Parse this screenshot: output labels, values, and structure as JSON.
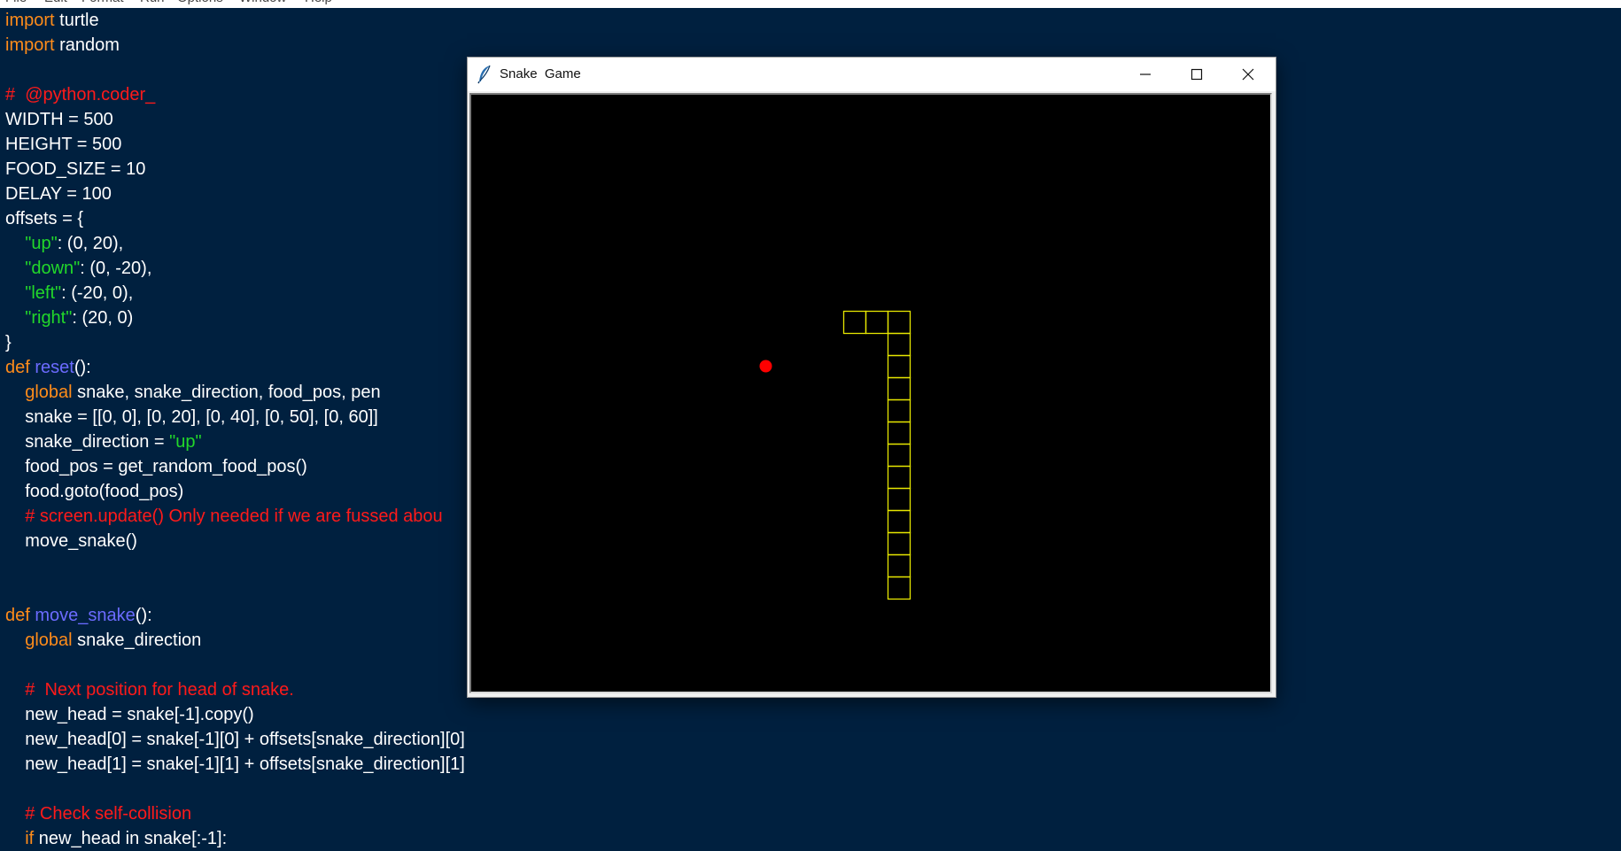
{
  "menubar": {
    "items": [
      "File",
      "Edit",
      "Format",
      "Run",
      "Options",
      "Window",
      "Help"
    ]
  },
  "editor": {
    "lines": [
      [
        {
          "t": "import",
          "c": "kw"
        },
        {
          "t": " turtle",
          "c": "n"
        }
      ],
      [
        {
          "t": "import",
          "c": "kw"
        },
        {
          "t": " random",
          "c": "n"
        }
      ],
      [],
      [
        {
          "t": "#  @python.coder_",
          "c": "cm"
        }
      ],
      [
        {
          "t": "WIDTH = 500",
          "c": "n"
        }
      ],
      [
        {
          "t": "HEIGHT = 500",
          "c": "n"
        }
      ],
      [
        {
          "t": "FOOD_SIZE = 10",
          "c": "n"
        }
      ],
      [
        {
          "t": "DELAY = 100",
          "c": "n"
        }
      ],
      [
        {
          "t": "offsets = {",
          "c": "n"
        }
      ],
      [
        {
          "t": "    ",
          "c": "n"
        },
        {
          "t": "\"up\"",
          "c": "str"
        },
        {
          "t": ": (0, 20),",
          "c": "n"
        }
      ],
      [
        {
          "t": "    ",
          "c": "n"
        },
        {
          "t": "\"down\"",
          "c": "str"
        },
        {
          "t": ": (0, -20),",
          "c": "n"
        }
      ],
      [
        {
          "t": "    ",
          "c": "n"
        },
        {
          "t": "\"left\"",
          "c": "str"
        },
        {
          "t": ": (-20, 0),",
          "c": "n"
        }
      ],
      [
        {
          "t": "    ",
          "c": "n"
        },
        {
          "t": "\"right\"",
          "c": "str"
        },
        {
          "t": ": (20, 0)",
          "c": "n"
        }
      ],
      [
        {
          "t": "}",
          "c": "n"
        }
      ],
      [
        {
          "t": "def",
          "c": "kw"
        },
        {
          "t": " ",
          "c": "n"
        },
        {
          "t": "reset",
          "c": "fn"
        },
        {
          "t": "():",
          "c": "n"
        }
      ],
      [
        {
          "t": "    ",
          "c": "n"
        },
        {
          "t": "global",
          "c": "kw"
        },
        {
          "t": " snake, snake_direction, food_pos, pen",
          "c": "n"
        }
      ],
      [
        {
          "t": "    snake = [[0, 0], [0, 20], [0, 40], [0, 50], [0, 60]]",
          "c": "n"
        }
      ],
      [
        {
          "t": "    snake_direction = ",
          "c": "n"
        },
        {
          "t": "\"up\"",
          "c": "str"
        }
      ],
      [
        {
          "t": "    food_pos = get_random_food_pos()",
          "c": "n"
        }
      ],
      [
        {
          "t": "    food.goto(food_pos)",
          "c": "n"
        }
      ],
      [
        {
          "t": "    ",
          "c": "n"
        },
        {
          "t": "# screen.update() Only needed if we are fussed abou",
          "c": "cm"
        }
      ],
      [
        {
          "t": "    move_snake()",
          "c": "n"
        }
      ],
      [],
      [],
      [
        {
          "t": "def",
          "c": "kw"
        },
        {
          "t": " ",
          "c": "n"
        },
        {
          "t": "move_snake",
          "c": "fn"
        },
        {
          "t": "():",
          "c": "n"
        }
      ],
      [
        {
          "t": "    ",
          "c": "n"
        },
        {
          "t": "global",
          "c": "kw"
        },
        {
          "t": " snake_direction",
          "c": "n"
        }
      ],
      [],
      [
        {
          "t": "    ",
          "c": "n"
        },
        {
          "t": "#  Next position for head of snake.",
          "c": "cm"
        }
      ],
      [
        {
          "t": "    new_head = snake[-1].copy()",
          "c": "n"
        }
      ],
      [
        {
          "t": "    new_head[0] = snake[-1][0] + offsets[snake_direction][0]",
          "c": "n"
        }
      ],
      [
        {
          "t": "    new_head[1] = snake[-1][1] + offsets[snake_direction][1]",
          "c": "n"
        }
      ],
      [],
      [
        {
          "t": "    ",
          "c": "n"
        },
        {
          "t": "# Check self-collision",
          "c": "cm"
        }
      ],
      [
        {
          "t": "    ",
          "c": "n"
        },
        {
          "t": "if",
          "c": "kw"
        },
        {
          "t": " new_head in snake[:-1]:",
          "c": "n"
        }
      ]
    ]
  },
  "window": {
    "title": "Snake  Game",
    "app_icon": "feather-icon",
    "buttons": [
      "minimize-icon",
      "maximize-icon",
      "close-icon"
    ]
  },
  "game": {
    "background": "#000000",
    "snake_color": "#e6e600",
    "food_color": "#ff0000",
    "snake_cells": [
      [
        -4,
        0
      ],
      [
        -3,
        0
      ],
      [
        -2,
        0
      ],
      [
        -2,
        -1
      ],
      [
        -2,
        -2
      ],
      [
        -2,
        -3
      ],
      [
        -2,
        -4
      ],
      [
        -2,
        -5
      ],
      [
        -2,
        -6
      ],
      [
        -2,
        -7
      ],
      [
        -2,
        -8
      ],
      [
        -2,
        -9
      ],
      [
        -2,
        -10
      ],
      [
        -2,
        -11
      ],
      [
        -2,
        -12
      ]
    ],
    "food_cell": [
      -8,
      -2
    ]
  }
}
